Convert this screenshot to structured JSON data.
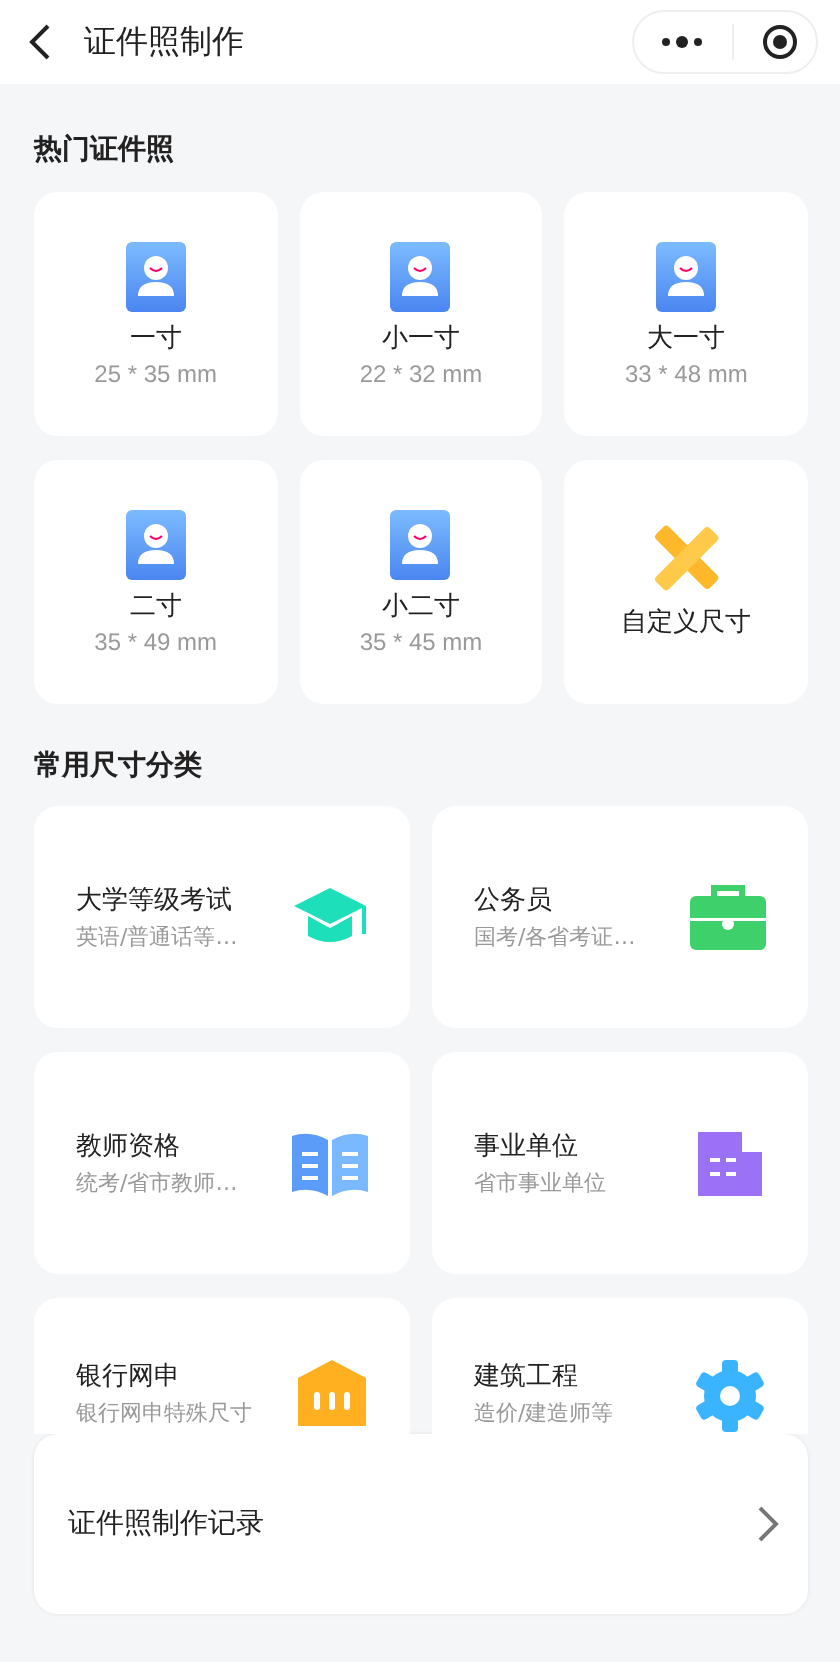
{
  "header": {
    "title": "证件照制作"
  },
  "hot_section": {
    "title": "热门证件照",
    "items": [
      {
        "kind": "photo",
        "name": "一寸",
        "size": "25 * 35 mm"
      },
      {
        "kind": "photo",
        "name": "小一寸",
        "size": "22 * 32 mm"
      },
      {
        "kind": "photo",
        "name": "大一寸",
        "size": "33 * 48 mm"
      },
      {
        "kind": "photo",
        "name": "二寸",
        "size": "35 * 49 mm"
      },
      {
        "kind": "photo",
        "name": "小二寸",
        "size": "35 * 45 mm"
      },
      {
        "kind": "custom",
        "name": "自定义尺寸"
      }
    ]
  },
  "category_section": {
    "title": "常用尺寸分类",
    "items": [
      {
        "name": "大学等级考试",
        "desc": "英语/普通话等…"
      },
      {
        "name": "公务员",
        "desc": "国考/各省考证…"
      },
      {
        "name": "教师资格",
        "desc": "统考/省市教师…"
      },
      {
        "name": "事业单位",
        "desc": "省市事业单位"
      },
      {
        "name": "银行网申",
        "desc": "银行网申特殊尺寸"
      },
      {
        "name": "建筑工程",
        "desc": "造价/建造师等"
      }
    ]
  },
  "record_bar": {
    "label": "证件照制作记录"
  }
}
